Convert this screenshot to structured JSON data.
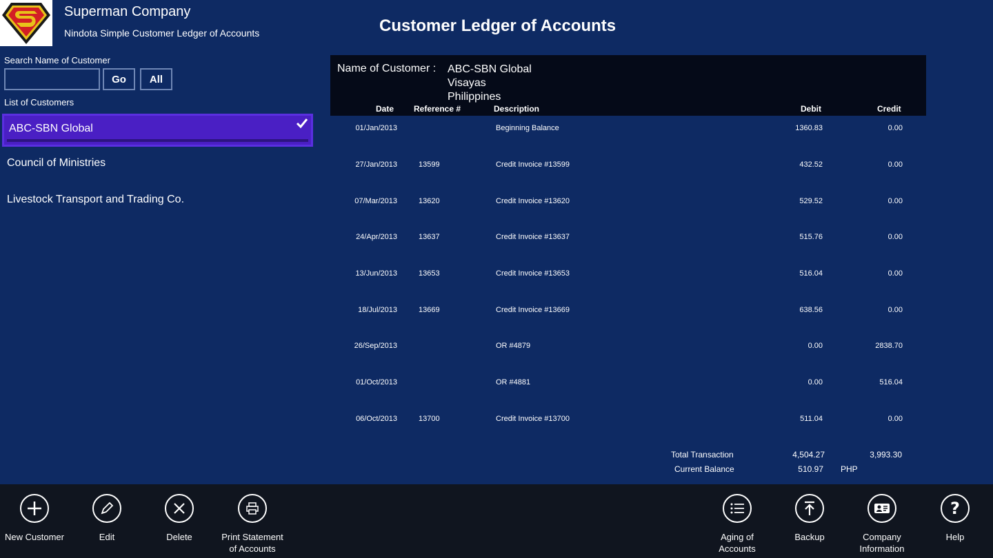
{
  "header": {
    "company_name": "Superman Company",
    "app_subtitle": "Nindota Simple Customer Ledger of Accounts",
    "page_title": "Customer Ledger of Accounts",
    "logo_icon": "superman-shield-icon"
  },
  "search": {
    "label": "Search Name of Customer",
    "value": "",
    "go_label": "Go",
    "all_label": "All"
  },
  "customers": {
    "label": "List of Customers",
    "items": [
      {
        "name": "ABC-SBN Global",
        "selected": true
      },
      {
        "name": "Council of Ministries",
        "selected": false
      },
      {
        "name": "Livestock Transport and Trading Co.",
        "selected": false
      }
    ]
  },
  "ledger": {
    "customer_label": "Name of Customer :",
    "customer_lines": [
      "ABC-SBN Global",
      "Visayas",
      "Philippines"
    ],
    "columns": {
      "date": "Date",
      "reference": "Reference #",
      "description": "Description",
      "debit": "Debit",
      "credit": "Credit"
    },
    "rows": [
      {
        "date": "01/Jan/2013",
        "ref": "",
        "desc": "Beginning Balance",
        "debit": "1360.83",
        "credit": "0.00"
      },
      {
        "date": "27/Jan/2013",
        "ref": "13599",
        "desc": "Credit Invoice #13599",
        "debit": "432.52",
        "credit": "0.00"
      },
      {
        "date": "07/Mar/2013",
        "ref": "13620",
        "desc": "Credit Invoice #13620",
        "debit": "529.52",
        "credit": "0.00"
      },
      {
        "date": "24/Apr/2013",
        "ref": "13637",
        "desc": "Credit Invoice #13637",
        "debit": "515.76",
        "credit": "0.00"
      },
      {
        "date": "13/Jun/2013",
        "ref": "13653",
        "desc": "Credit Invoice #13653",
        "debit": "516.04",
        "credit": "0.00"
      },
      {
        "date": "18/Jul/2013",
        "ref": "13669",
        "desc": "Credit Invoice #13669",
        "debit": "638.56",
        "credit": "0.00"
      },
      {
        "date": "26/Sep/2013",
        "ref": "",
        "desc": "OR #4879",
        "debit": "0.00",
        "credit": "2838.70"
      },
      {
        "date": "01/Oct/2013",
        "ref": "",
        "desc": "OR #4881",
        "debit": "0.00",
        "credit": "516.04"
      },
      {
        "date": "06/Oct/2013",
        "ref": "13700",
        "desc": "Credit Invoice #13700",
        "debit": "511.04",
        "credit": "0.00"
      }
    ],
    "totals": {
      "total_label": "Total Transaction",
      "total_debit": "4,504.27",
      "total_credit": "3,993.30",
      "balance_label": "Current Balance",
      "balance_value": "510.97",
      "currency": "PHP"
    }
  },
  "appbar": {
    "new_customer": "New Customer",
    "edit": "Edit",
    "delete": "Delete",
    "print_line1": "Print Statement",
    "print_line2": "of Accounts",
    "aging_line1": "Aging of",
    "aging_line2": "Accounts",
    "backup": "Backup",
    "company_line1": "Company",
    "company_line2": "Information",
    "help": "Help"
  },
  "colors": {
    "background": "#0e2a63",
    "selected": "#4a1fc4",
    "appbar": "#10151f",
    "ledger_header": "#050a18"
  }
}
